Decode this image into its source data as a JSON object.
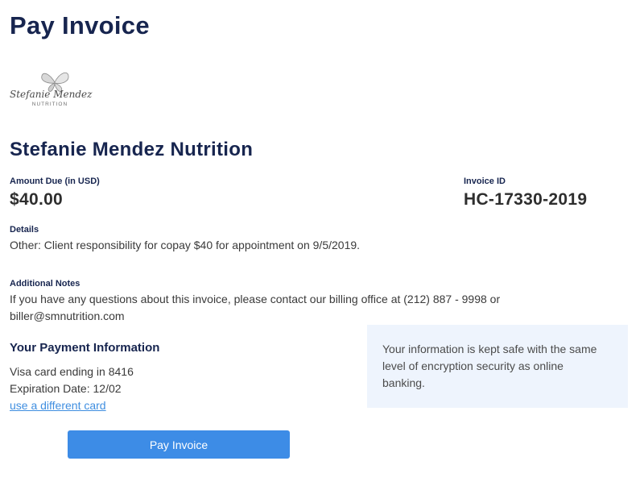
{
  "page": {
    "title": "Pay Invoice"
  },
  "logo": {
    "script_text": "Stefanie Mendez",
    "sub_text": "NUTRITION"
  },
  "business": {
    "name": "Stefanie Mendez Nutrition"
  },
  "invoice": {
    "amount_label": "Amount Due (in USD)",
    "amount_value": "$40.00",
    "id_label": "Invoice ID",
    "id_value": "HC-17330-2019",
    "details_label": "Details",
    "details_text": "Other: Client responsibility for copay $40 for appointment on 9/5/2019.",
    "notes_label": "Additional Notes",
    "notes_line1": "If you have any questions about this invoice, please contact our billing office at (212) 887 - 9998 or",
    "notes_line2": "biller@smnutrition.com"
  },
  "payment": {
    "heading": "Your Payment Information",
    "card_text": "Visa card ending in 8416",
    "expiration_text": "Expiration Date: 12/02",
    "change_card_link": "use a different card",
    "pay_button_label": "Pay Invoice"
  },
  "security": {
    "message": "Your information is kept safe with the same level of encryption security as online banking."
  },
  "colors": {
    "heading_navy": "#17254f",
    "button_blue": "#3d8ce6",
    "link_blue": "#3f8ee0",
    "info_box_bg": "#eef4fd"
  },
  "icons": {
    "logo_mark": "butterfly-logo-icon"
  }
}
